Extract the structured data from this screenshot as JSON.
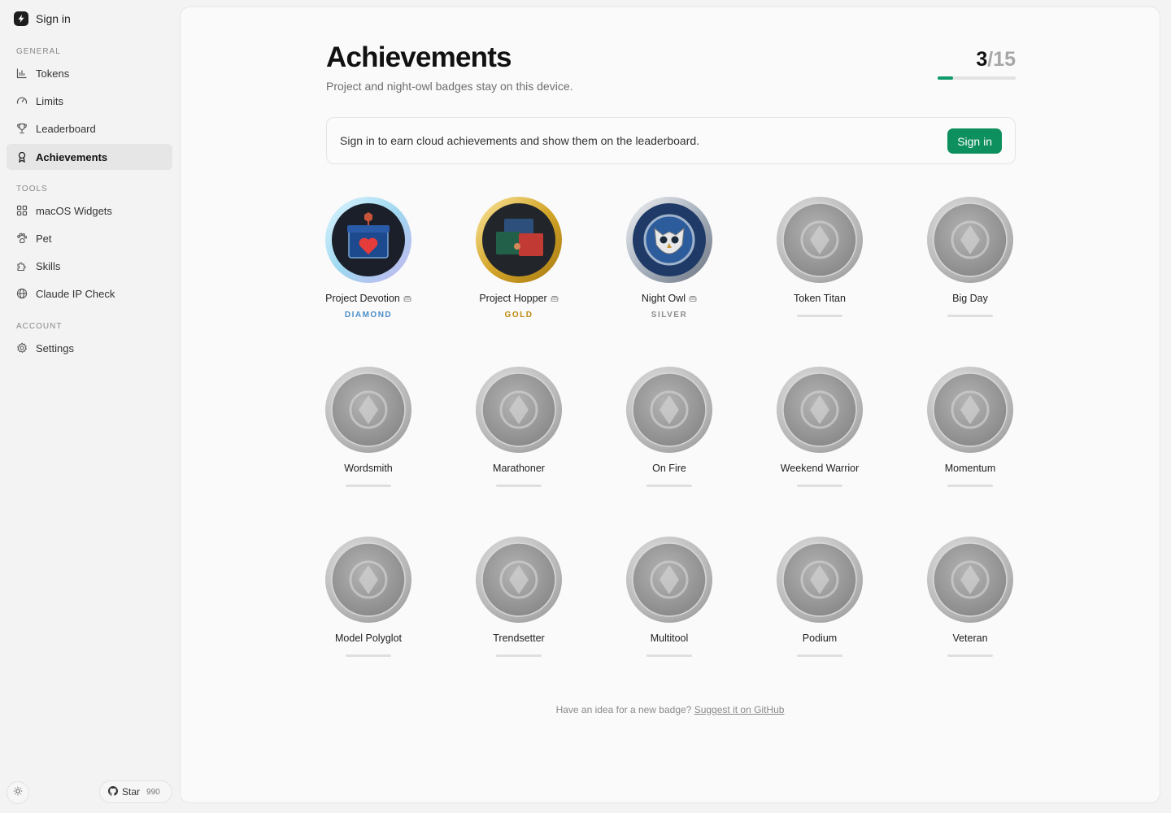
{
  "brand": {
    "label": "Sign in"
  },
  "sidebar": {
    "sections": [
      {
        "label": "GENERAL",
        "items": [
          {
            "label": "Tokens",
            "icon": "bar-chart-icon"
          },
          {
            "label": "Limits",
            "icon": "gauge-icon"
          },
          {
            "label": "Leaderboard",
            "icon": "trophy-icon"
          },
          {
            "label": "Achievements",
            "icon": "award-icon",
            "active": true
          }
        ]
      },
      {
        "label": "TOOLS",
        "items": [
          {
            "label": "macOS Widgets",
            "icon": "grid-icon"
          },
          {
            "label": "Pet",
            "icon": "paw-icon"
          },
          {
            "label": "Skills",
            "icon": "puzzle-icon"
          },
          {
            "label": "Claude IP Check",
            "icon": "globe-icon"
          }
        ]
      },
      {
        "label": "ACCOUNT",
        "items": [
          {
            "label": "Settings",
            "icon": "gear-icon"
          }
        ]
      }
    ],
    "star": {
      "label": "Star",
      "count": "990"
    }
  },
  "header": {
    "title": "Achievements",
    "subtitle": "Project and night-owl badges stay on this device.",
    "progress": {
      "current": "3",
      "separator": "/",
      "total": "15",
      "fraction": 0.2
    }
  },
  "banner": {
    "text": "Sign in to earn cloud achievements and show them on the leaderboard.",
    "button": "Sign in"
  },
  "colors": {
    "accent": "#0e8f5e",
    "diamond": "#4a8fc9",
    "gold": "#c08a12",
    "silver": "#8c8c8c"
  },
  "badges": [
    {
      "name": "Project Devotion",
      "tier": "DIAMOND",
      "tier_color": "#4a8fc9",
      "local": true,
      "icon": "chest-heart-medal"
    },
    {
      "name": "Project Hopper",
      "tier": "GOLD",
      "tier_color": "#c08a12",
      "local": true,
      "icon": "folders-medal"
    },
    {
      "name": "Night Owl",
      "tier": "SILVER",
      "tier_color": "#8c8c8c",
      "local": true,
      "icon": "owl-medal"
    },
    {
      "name": "Token Titan",
      "tier": "",
      "local": false,
      "icon": "titan-medal"
    },
    {
      "name": "Big Day",
      "tier": "",
      "local": false,
      "icon": "skyline-medal"
    },
    {
      "name": "Wordsmith",
      "tier": "",
      "local": false,
      "icon": "pen-medal"
    },
    {
      "name": "Marathoner",
      "tier": "",
      "local": false,
      "icon": "shoe-medal"
    },
    {
      "name": "On Fire",
      "tier": "",
      "local": false,
      "icon": "flame-medal"
    },
    {
      "name": "Weekend Warrior",
      "tier": "",
      "local": false,
      "icon": "helmet-medal"
    },
    {
      "name": "Momentum",
      "tier": "",
      "local": false,
      "icon": "target-medal"
    },
    {
      "name": "Model Polyglot",
      "tier": "",
      "local": false,
      "icon": "network-medal"
    },
    {
      "name": "Trendsetter",
      "tier": "",
      "local": false,
      "icon": "rocket-medal"
    },
    {
      "name": "Multitool",
      "tier": "",
      "local": false,
      "icon": "tools-medal"
    },
    {
      "name": "Podium",
      "tier": "",
      "local": false,
      "icon": "podium-medal"
    },
    {
      "name": "Veteran",
      "tier": "",
      "local": false,
      "icon": "shield-medal"
    }
  ],
  "footer": {
    "text": "Have an idea for a new badge?",
    "link": "Suggest it on GitHub"
  }
}
